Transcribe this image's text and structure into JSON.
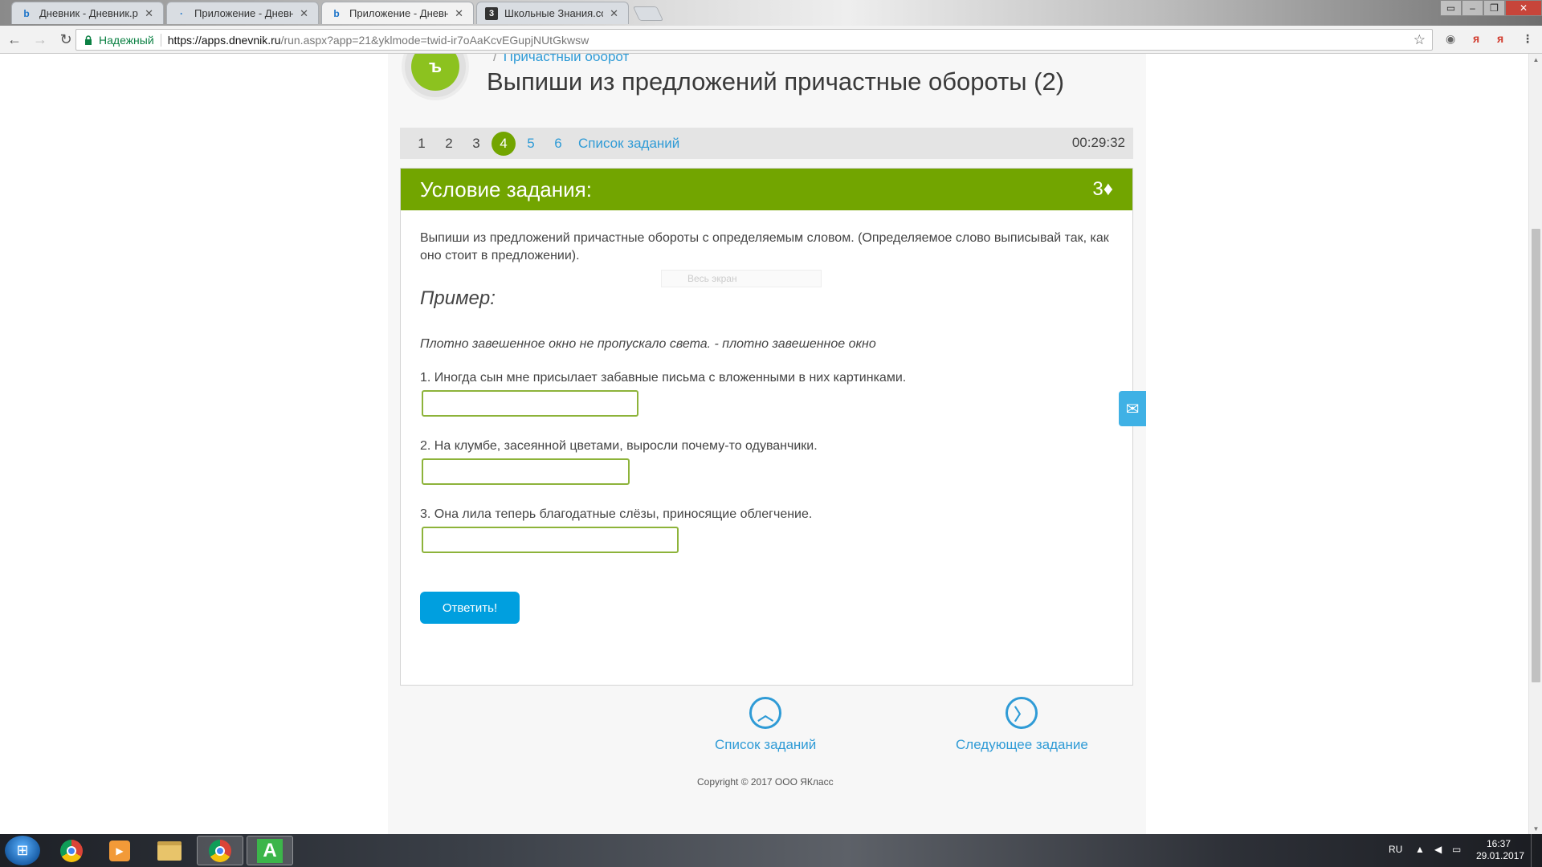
{
  "browser": {
    "tabs": [
      {
        "label": "Дневник - Дневник.ру",
        "icon": "dnevnik-icon",
        "favicon": "b"
      },
      {
        "label": "Приложение - Дневник",
        "icon": "dot-icon",
        "favicon": "·"
      },
      {
        "label": "Приложение - Дневник",
        "icon": "dnevnik-icon",
        "favicon": "b"
      },
      {
        "label": "Школьные Знания.com",
        "icon": "znanija-icon",
        "favicon": "3"
      }
    ],
    "tab_close": "✕",
    "secure_label": "Надежный",
    "url_host": "https://apps.dnevnik.ru",
    "url_rest": "/run.aspx?app=21&yklmode=twid-ir7oAaKcvEGupjNUtGkwsw"
  },
  "page": {
    "breadcrumb": "Причастный оборот",
    "title": "Выпиши из предложений причастные обороты (2)",
    "task_numbers": [
      "1",
      "2",
      "3",
      "4",
      "5",
      "6"
    ],
    "current_task": "4",
    "task_list_link": "Список заданий",
    "timer": "00:29:32",
    "task_header": "Условие задания:",
    "score": "3♦",
    "instruction": "Выпиши из предложений причастные обороты с определяемым словом. (Определяемое слово выписывай так, как оно стоит в предложении).",
    "fullscreen_hint": "Весь экран",
    "example_heading": "Пример:",
    "example_text": "Плотно завешенное окно не пропускало света. - плотно завешенное окно",
    "questions": [
      {
        "text": "1. Иногда сын мне присылает забавные письма с вложенными в них картинками.",
        "value": ""
      },
      {
        "text": "2. На клумбе, засеянной цветами, выросли почему-то одуванчики.",
        "value": ""
      },
      {
        "text": "3. Она лила теперь благодатные слёзы, приносящие облегчение.",
        "value": ""
      }
    ],
    "submit_label": "Ответить!",
    "footer_task_list": "Список заданий",
    "footer_next": "Следующее задание",
    "copyright": "Copyright © 2017 ООО ЯКласс"
  },
  "taskbar": {
    "language": "RU",
    "time": "16:37",
    "date": "29.01.2017"
  },
  "colors": {
    "accent_green": "#72a500",
    "link_blue": "#2f9bd6",
    "button_blue": "#009fdf",
    "input_border": "#8db33a"
  }
}
